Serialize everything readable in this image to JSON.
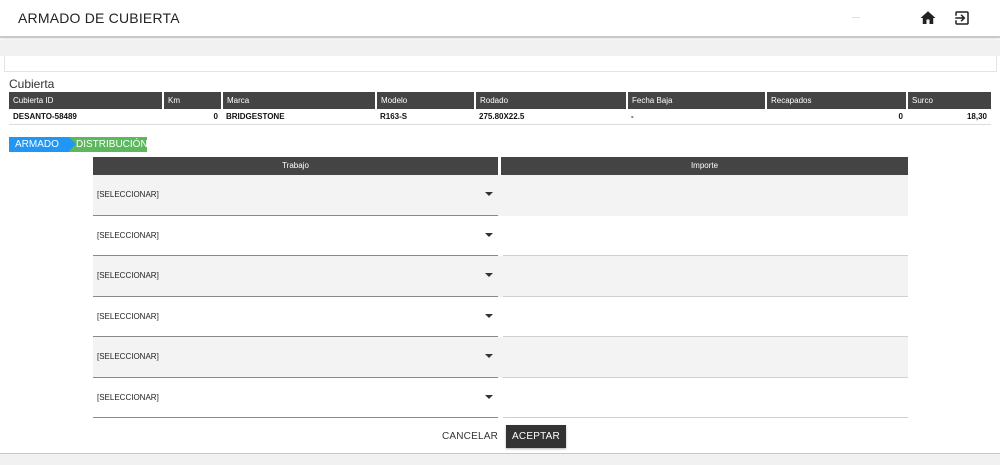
{
  "appbar": {
    "title": "ARMADO DE CUBIERTA",
    "icons": {
      "home": "home-icon",
      "logout": "logout-icon"
    }
  },
  "section": {
    "title": "Cubierta"
  },
  "info_table": {
    "headers": [
      "Cubierta ID",
      "Km",
      "Marca",
      "Modelo",
      "Rodado",
      "Fecha Baja",
      "Recapados",
      "Surco"
    ],
    "row": [
      "DESANTO-58489",
      "0",
      "BRIDGESTONE",
      "R163-S",
      "275.80X22.5",
      "-",
      "0",
      "18,30"
    ]
  },
  "steps": {
    "armado": "ARMADO",
    "distribucion": "DISTRIBUCIÓN"
  },
  "work_table": {
    "headers": {
      "trabajo": "Trabajo",
      "importe": "Importe"
    },
    "rows": [
      {
        "trabajo": "[SELECCIONAR]",
        "importe": ""
      },
      {
        "trabajo": "[SELECCIONAR]",
        "importe": ""
      },
      {
        "trabajo": "[SELECCIONAR]",
        "importe": ""
      },
      {
        "trabajo": "[SELECCIONAR]",
        "importe": ""
      },
      {
        "trabajo": "[SELECCIONAR]",
        "importe": ""
      },
      {
        "trabajo": "[SELECCIONAR]",
        "importe": ""
      }
    ]
  },
  "actions": {
    "cancel": "CANCELAR",
    "accept": "ACEPTAR"
  },
  "colors": {
    "header_bg": "#444444",
    "chip_armado": "#2196f3",
    "chip_distribucion": "#5cb85c",
    "accept_bg": "#333333"
  }
}
